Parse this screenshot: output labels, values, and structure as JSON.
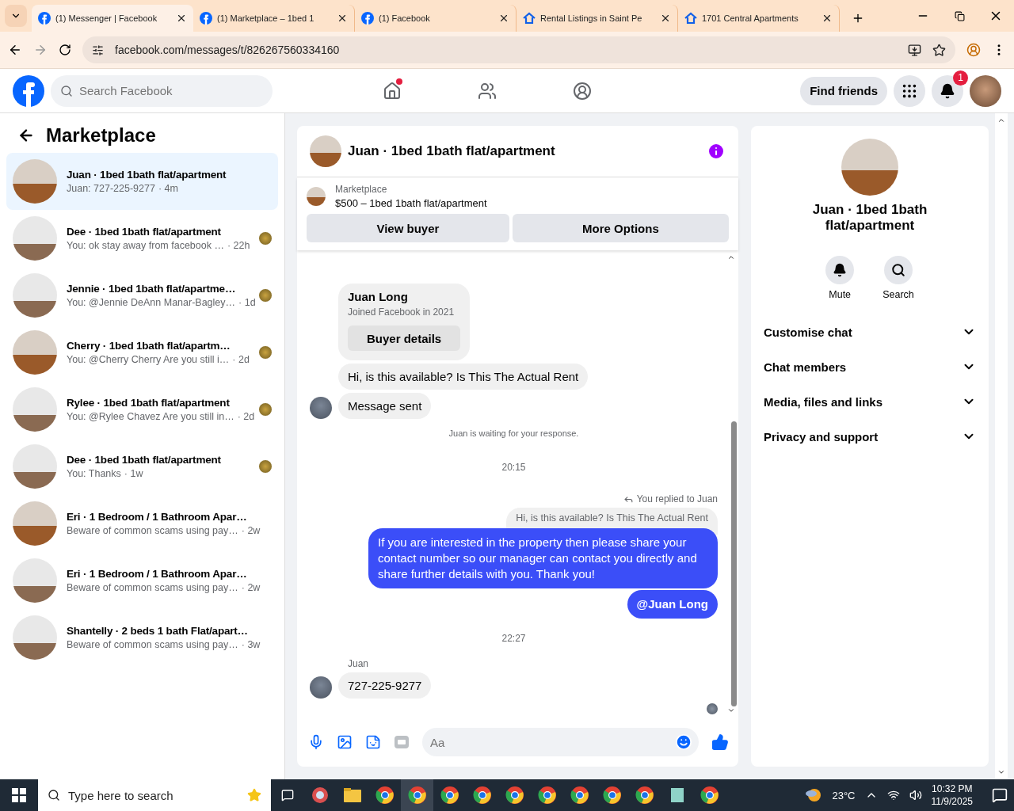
{
  "browser": {
    "tabs": [
      {
        "title": "(1) Messenger | Facebook",
        "selected": true
      },
      {
        "title": "(1) Marketplace – 1bed 1",
        "selected": false
      },
      {
        "title": "(1) Facebook",
        "selected": false
      },
      {
        "title": "Rental Listings in Saint Pe",
        "selected": false
      },
      {
        "title": "1701 Central Apartments",
        "selected": false
      }
    ],
    "url": "facebook.com/messages/t/826267560334160"
  },
  "header": {
    "search_placeholder": "Search Facebook",
    "find_friends": "Find friends",
    "notification_count": "1",
    "home_unread": true
  },
  "sidebar": {
    "title": "Marketplace",
    "conversations": [
      {
        "name": "Juan · 1bed 1bath flat/apartment",
        "preview": "Juan: 727-225-9277",
        "time": "· 4m",
        "selected": true,
        "seen_avatar": false
      },
      {
        "name": "Dee · 1bed 1bath flat/apartment",
        "preview": "You: ok stay away from facebook …",
        "time": "· 22h",
        "selected": false,
        "seen_avatar": true
      },
      {
        "name": "Jennie · 1bed 1bath flat/apartme…",
        "preview": "You: @Jennie DeAnn Manar-Bagley…",
        "time": "· 1d",
        "selected": false,
        "seen_avatar": true
      },
      {
        "name": "Cherry · 1bed 1bath flat/apartm…",
        "preview": "You: @Cherry Cherry Are you still i…",
        "time": "· 2d",
        "selected": false,
        "seen_avatar": true
      },
      {
        "name": "Rylee · 1bed 1bath flat/apartment",
        "preview": "You: @Rylee Chavez Are you still in…",
        "time": "· 2d",
        "selected": false,
        "seen_avatar": true
      },
      {
        "name": "Dee · 1bed 1bath flat/apartment",
        "preview": "You: Thanks",
        "time": "· 1w",
        "selected": false,
        "seen_avatar": true
      },
      {
        "name": "Eri · 1 Bedroom / 1 Bathroom Apar…",
        "preview": "Beware of common scams using pay…",
        "time": "· 2w",
        "selected": false,
        "seen_avatar": false
      },
      {
        "name": "Eri · 1 Bedroom / 1 Bathroom Apar…",
        "preview": "Beware of common scams using pay…",
        "time": "· 2w",
        "selected": false,
        "seen_avatar": false
      },
      {
        "name": "Shantelly · 2 beds 1 bath Flat/apart…",
        "preview": "Beware of common scams using pay…",
        "time": "· 3w",
        "selected": false,
        "seen_avatar": false
      }
    ]
  },
  "chat": {
    "title": "Juan · 1bed 1bath flat/apartment",
    "listing": {
      "label": "Marketplace",
      "title": "$500 – 1bed 1bath flat/apartment",
      "buttons": [
        "View buyer",
        "More Options"
      ]
    },
    "messages": [
      {
        "kind": "profile_card",
        "name": "Juan Long",
        "subtitle": "Joined Facebook in 2021",
        "button": "Buyer details"
      },
      {
        "kind": "incoming",
        "text": "Hi, is this available? Is This The Actual Rent",
        "avatar": false
      },
      {
        "kind": "incoming",
        "text": "Message sent",
        "avatar": true
      },
      {
        "kind": "notice",
        "text": "Juan is waiting for your response."
      },
      {
        "kind": "timestamp",
        "text": "20:15"
      },
      {
        "kind": "reply_label",
        "text": "You replied to Juan"
      },
      {
        "kind": "quoted",
        "text": "Hi, is this available? Is This The Actual Rent"
      },
      {
        "kind": "outgoing",
        "text": "If you are interested in the property then please share your contact number so our manager can contact you directly and share further details with you. Thank you!"
      },
      {
        "kind": "mention",
        "text": "@Juan Long"
      },
      {
        "kind": "timestamp",
        "text": "22:27"
      },
      {
        "kind": "sender_name",
        "text": "Juan"
      },
      {
        "kind": "incoming",
        "text": "727-225-9277",
        "avatar": true
      },
      {
        "kind": "seen"
      }
    ],
    "composer_placeholder": "Aa"
  },
  "details": {
    "title": "Juan · 1bed 1bath flat/apartment",
    "actions": [
      {
        "label": "Mute"
      },
      {
        "label": "Search"
      }
    ],
    "sections": [
      "Customise chat",
      "Chat members",
      "Media, files and links",
      "Privacy and support"
    ]
  },
  "taskbar": {
    "search_placeholder": "Type here to search",
    "temperature": "23°C",
    "time": "10:32 PM",
    "date": "11/9/2025"
  }
}
